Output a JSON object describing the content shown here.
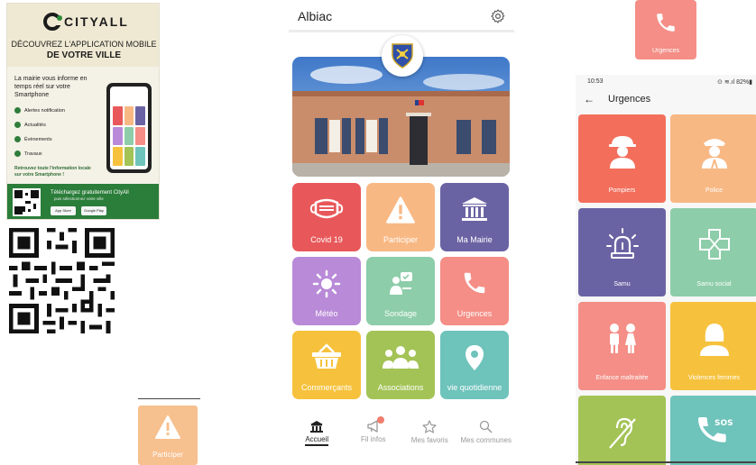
{
  "flyer": {
    "brand": "CITYALL",
    "headline_1": "DÉCOUVREZ L'APPLICATION MOBILE",
    "headline_2": "DE VOTRE VILLE",
    "intro": "La mairie vous informe en temps réel sur votre Smartphone",
    "features": [
      "Alertes notification",
      "Actualités",
      "Évènements",
      "Travaux"
    ],
    "retrouvez": "Retrouvez toute l'information locale sur votre Smartphone !",
    "download": "Téléchargez gratuitement CityAll",
    "download_sub": "puis sélectionnez votre ville",
    "store_apple": "App Store",
    "store_google": "Google Play"
  },
  "participer_crop": {
    "label": "Participer"
  },
  "urgences_crop": {
    "label": "Urgences"
  },
  "app": {
    "title": "Albiac",
    "tiles": [
      {
        "label": "Covid 19",
        "icon": "mask-icon",
        "color": "#e8585a"
      },
      {
        "label": "Participer",
        "icon": "alert-icon",
        "color": "#f8b884"
      },
      {
        "label": "Ma Mairie",
        "icon": "town-hall-icon",
        "color": "#6a63a3"
      },
      {
        "label": "Météo",
        "icon": "sun-icon",
        "color": "#b98ad8"
      },
      {
        "label": "Sondage",
        "icon": "survey-icon",
        "color": "#8dcda9"
      },
      {
        "label": "Urgences",
        "icon": "phone-icon",
        "color": "#f48e86"
      },
      {
        "label": "Commerçants",
        "icon": "basket-icon",
        "color": "#f6c23d"
      },
      {
        "label": "Associations",
        "icon": "people-icon",
        "color": "#a3c356"
      },
      {
        "label": "vie quotidienne",
        "icon": "location-pin-icon",
        "color": "#6ec3bb"
      }
    ],
    "nav": [
      {
        "label": "Accueil",
        "icon": "home-icon",
        "active": true
      },
      {
        "label": "Fil infos",
        "icon": "megaphone-icon",
        "active": false
      },
      {
        "label": "Mes favoris",
        "icon": "star-icon",
        "active": false
      },
      {
        "label": "Mes communes",
        "icon": "search-icon",
        "active": false
      }
    ]
  },
  "urgences_screen": {
    "time": "10:53",
    "battery": "82%",
    "title": "Urgences",
    "tiles": [
      {
        "label": "Pompiers",
        "icon": "firefighter-icon",
        "color": "#f36f5c"
      },
      {
        "label": "Police",
        "icon": "police-icon",
        "color": "#f8b884"
      },
      {
        "label": "Samu",
        "icon": "siren-icon",
        "color": "#6a63a3"
      },
      {
        "label": "Samu social",
        "icon": "medical-cross-icon",
        "color": "#8dcda9"
      },
      {
        "label": "Enfance maltraitée",
        "icon": "children-icon",
        "color": "#f48e86"
      },
      {
        "label": "Violences femmes",
        "icon": "woman-icon",
        "color": "#f6c23d"
      },
      {
        "label": "",
        "icon": "deaf-icon",
        "color": "#a3c356"
      },
      {
        "label": "",
        "icon": "sos-phone-icon",
        "color": "#6ec3bb"
      }
    ]
  }
}
